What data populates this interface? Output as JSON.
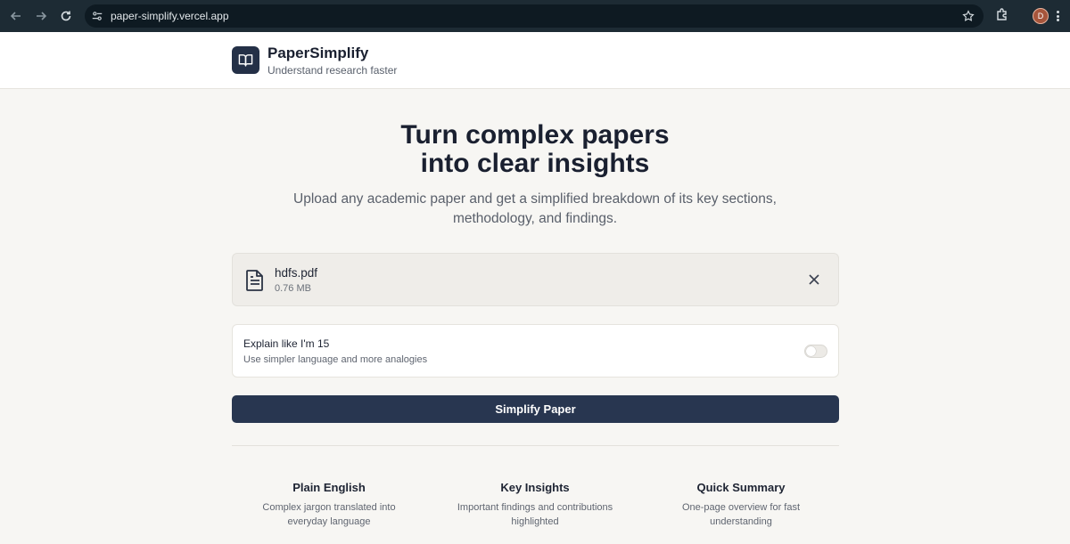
{
  "browser": {
    "url": "paper-simplify.vercel.app",
    "profile_initial": "D"
  },
  "header": {
    "brand": "PaperSimplify",
    "tagline": "Understand research faster",
    "logo_icon": "book-open-icon"
  },
  "hero": {
    "title_line1": "Turn complex papers",
    "title_line2": "into clear insights",
    "subtitle_line1": "Upload any academic paper and get a simplified breakdown of its key sections,",
    "subtitle_line2": "methodology, and findings."
  },
  "file": {
    "name": "hdfs.pdf",
    "size": "0.76 MB",
    "icon": "file-text-icon"
  },
  "option": {
    "title": "Explain like I'm 15",
    "description": "Use simpler language and more analogies",
    "enabled": false
  },
  "action": {
    "simplify_label": "Simplify Paper"
  },
  "features": [
    {
      "title": "Plain English",
      "desc_line1": "Complex jargon translated into",
      "desc_line2": "everyday language"
    },
    {
      "title": "Key Insights",
      "desc_line1": "Important findings and contributions",
      "desc_line2": "highlighted"
    },
    {
      "title": "Quick Summary",
      "desc_line1": "One-page overview for fast",
      "desc_line2": "understanding"
    }
  ],
  "colors": {
    "primary": "#283650",
    "background": "#f7f6f3",
    "browser_bar": "#1d2b34"
  }
}
